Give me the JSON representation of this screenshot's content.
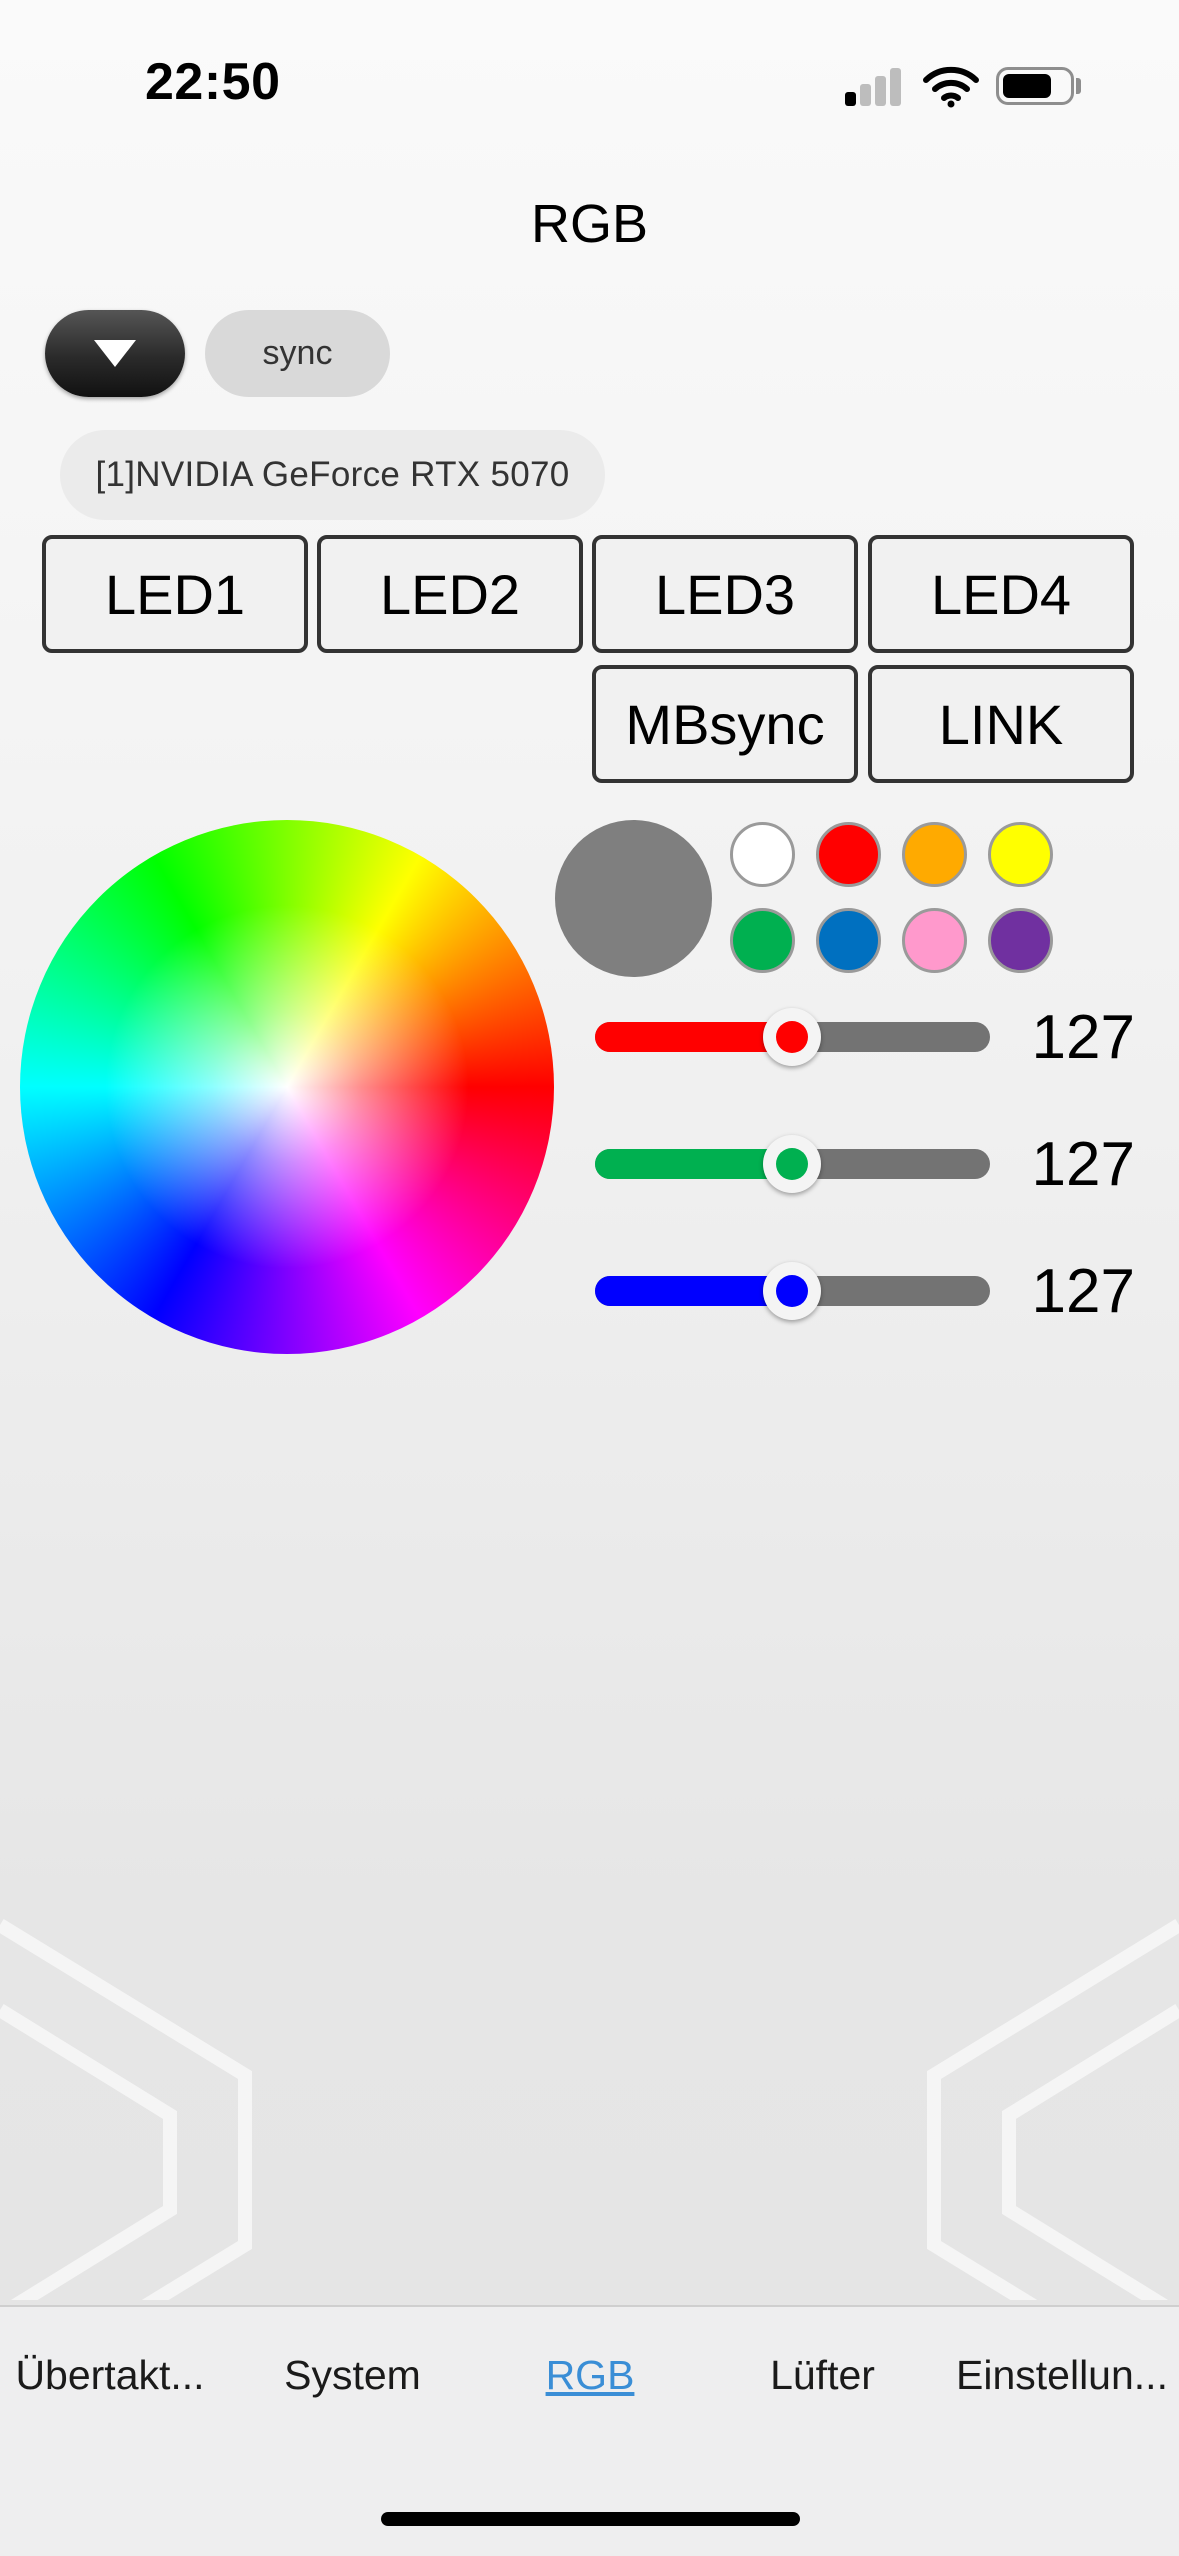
{
  "status_bar": {
    "time": "22:50",
    "battery_level": 0.7,
    "signal_bars_active": 1
  },
  "header": {
    "title": "RGB"
  },
  "controls": {
    "dropdown_icon": "triangle-down-icon",
    "sync_label": "sync",
    "device_name": "[1]NVIDIA GeForce RTX 5070"
  },
  "led_buttons": {
    "led1": "LED1",
    "led2": "LED2",
    "led3": "LED3",
    "led4": "LED4",
    "mbsync": "MBsync",
    "link": "LINK"
  },
  "color": {
    "current_color": "#7f7f7f",
    "presets": [
      "#ffffff",
      "#ff0000",
      "#ffaa00",
      "#ffff00",
      "#00b050",
      "#0070c0",
      "#ff99cc",
      "#7030a0"
    ]
  },
  "sliders": {
    "red": {
      "value": "127",
      "max": 255,
      "color": "#ff0000"
    },
    "green": {
      "value": "127",
      "max": 255,
      "color": "#00b050"
    },
    "blue": {
      "value": "127",
      "max": 255,
      "color": "#0000ff"
    }
  },
  "tabs": {
    "overclock": "Übertakt...",
    "system": "System",
    "rgb": "RGB",
    "fan": "Lüfter",
    "settings": "Einstellun..."
  },
  "active_tab": "RGB"
}
